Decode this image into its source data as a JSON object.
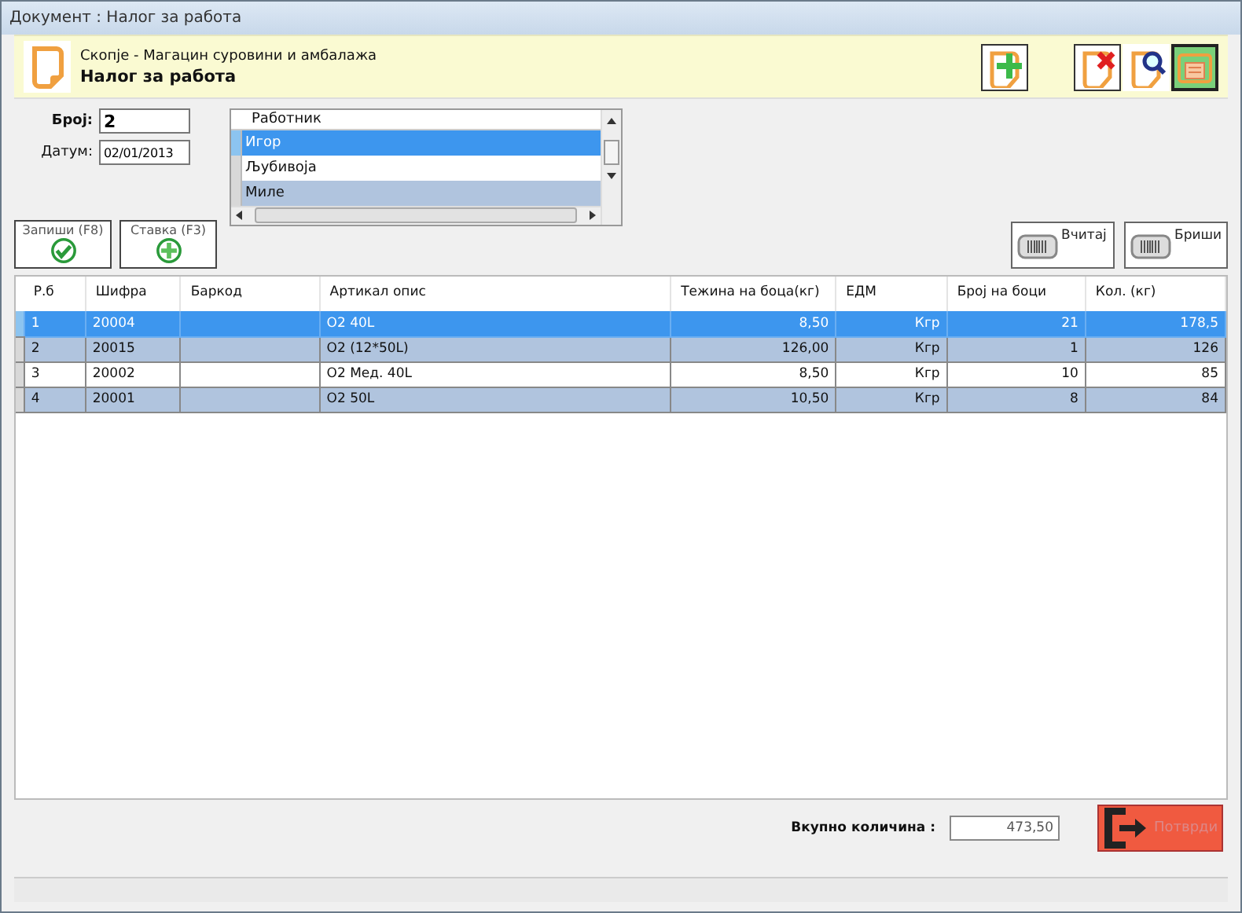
{
  "window": {
    "title": "Документ : Налог за работа"
  },
  "header": {
    "subtitle": "Скопје - Магацин суровини и амбалажа",
    "title": "Налог за работа"
  },
  "form": {
    "number": {
      "label": "Број:",
      "value": "2"
    },
    "date": {
      "label": "Датум:",
      "value": "02/01/2013"
    }
  },
  "workers": {
    "column": "Работник",
    "rows": [
      {
        "name": "Игор",
        "selected": true
      },
      {
        "name": "Љубивоја",
        "selected": false
      },
      {
        "name": "Миле",
        "selected": false
      }
    ]
  },
  "actions": [
    {
      "label": "Запиши (F8)",
      "kind": "save"
    },
    {
      "label": "Ставка (F3)",
      "kind": "add"
    }
  ],
  "barcode_buttons": [
    {
      "label": "Вчитај"
    },
    {
      "label": "Бриши"
    }
  ],
  "table": {
    "columns": [
      "Р.б",
      "Шифра",
      "Баркод",
      "Артикал опис",
      "Тежина на боца(кг)",
      "ЕДМ",
      "Број на боци",
      "Кол. (кг)"
    ],
    "rows": [
      {
        "cells": [
          "1",
          "20004",
          "",
          "О2 40L",
          "8,50",
          "Кгр",
          "21",
          "178,5"
        ],
        "selected": true
      },
      {
        "cells": [
          "2",
          "20015",
          "",
          "О2 (12*50L)",
          "126,00",
          "Кгр",
          "1",
          "126"
        ],
        "selected": false
      },
      {
        "cells": [
          "3",
          "20002",
          "",
          "О2 Мед. 40L",
          "8,50",
          "Кгр",
          "10",
          "85"
        ],
        "selected": false
      },
      {
        "cells": [
          "4",
          "20001",
          "",
          "О2 50L",
          "10,50",
          "Кгр",
          "8",
          "84"
        ],
        "selected": false
      }
    ]
  },
  "total": {
    "label": "Вкупно количина :",
    "value": "473,50"
  },
  "confirm": {
    "label": "Потврди"
  }
}
